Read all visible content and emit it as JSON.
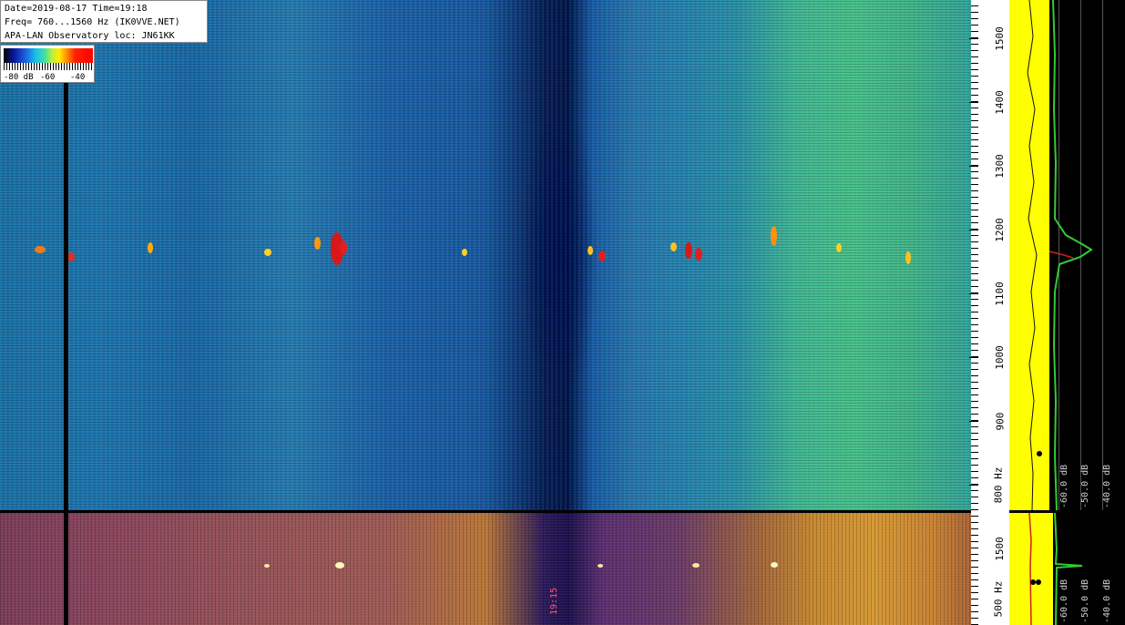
{
  "info": {
    "date_line": "Date=2019-08-17 Time=19:18",
    "freq_line": "Freq= 760...1560 Hz (IK0VVE.NET)",
    "location_line": "APA-LAN Observatory loc: JN61KK"
  },
  "legend": {
    "labels": [
      "-80 dB",
      "-60",
      "-40"
    ]
  },
  "axis_upper": {
    "labels": [
      "1500",
      "1400",
      "1300",
      "1200",
      "1100",
      "1000",
      "900",
      "800 Hz"
    ]
  },
  "axis_lower": {
    "labels": [
      "1500",
      "500 Hz"
    ]
  },
  "spectrum_upper": {
    "labels": [
      "-60.0 dB",
      "-50.0 dB",
      "-40.0 dB"
    ]
  },
  "spectrum_lower": {
    "labels": [
      "-60.0 dB",
      "-50.0 dB",
      "-40.0 dB"
    ]
  },
  "lower_timestamp": "19:15",
  "colors": {
    "waterfall_upper": "#1f6fa7",
    "waterfall_lower": "#9d5a58",
    "signal": "#e02020",
    "spectrum_fill": "#ffff00",
    "spectrum_trace": "#33cc33"
  }
}
